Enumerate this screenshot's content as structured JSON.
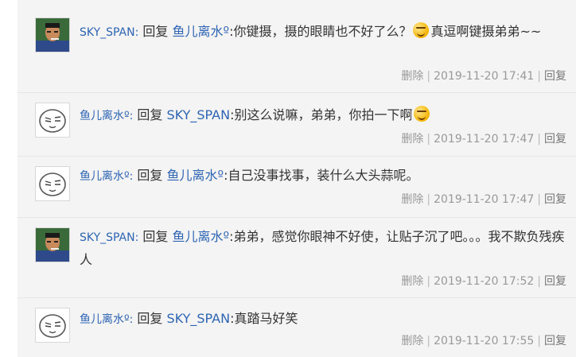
{
  "replies": [
    {
      "user": "SKY_SPAN:",
      "reply_word": "回复",
      "target": "鱼儿离水º",
      "text_before": ":你键摄，摄的眼睛也不好了么？",
      "text_after": "真逗啊键摄弟弟~~",
      "has_emoji": true,
      "avatar": "photo-avatar",
      "delete_label": "删除",
      "separator": "|",
      "time": "2019-11-20 17:41",
      "reply_label": "回复"
    },
    {
      "user": "鱼儿离水º:",
      "reply_word": "回复",
      "target": "SKY_SPAN",
      "text_before": ":别这么说嘛，弟弟，你拍一下啊",
      "text_after": "",
      "has_emoji": true,
      "avatar": "sketch-face-avatar",
      "delete_label": "删除",
      "separator": "|",
      "time": "2019-11-20 17:47",
      "reply_label": "回复"
    },
    {
      "user": "鱼儿离水º:",
      "reply_word": "回复",
      "target": "鱼儿离水º",
      "text_before": ":自己没事找事，装什么大头蒜呢。",
      "text_after": "",
      "has_emoji": false,
      "avatar": "sketch-face-avatar",
      "delete_label": "删除",
      "separator": "|",
      "time": "2019-11-20 17:47",
      "reply_label": "回复"
    },
    {
      "user": "SKY_SPAN:",
      "reply_word": "回复",
      "target": "鱼儿离水º",
      "text_before": ":弟弟，感觉你眼神不好使，让贴子沉了吧。。。我不欺负残疾人",
      "text_after": "",
      "has_emoji": false,
      "avatar": "photo-avatar",
      "delete_label": "删除",
      "separator": "|",
      "time": "2019-11-20 17:52",
      "reply_label": "回复"
    },
    {
      "user": "鱼儿离水º:",
      "reply_word": "回复",
      "target": "SKY_SPAN",
      "text_before": ":真踏马好笑",
      "text_after": "",
      "has_emoji": false,
      "avatar": "sketch-face-avatar",
      "delete_label": "删除",
      "separator": "|",
      "time": "2019-11-20 17:55",
      "reply_label": "回复"
    }
  ]
}
